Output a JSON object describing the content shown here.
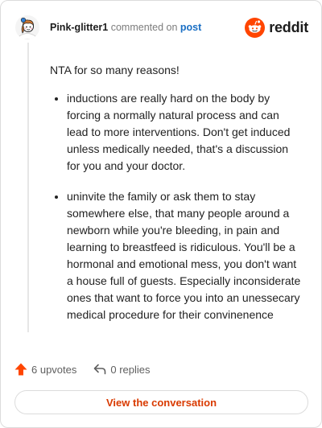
{
  "header": {
    "username": "Pink-glitter1",
    "action_text": "commented on",
    "post_link": "post",
    "brand_name": "reddit"
  },
  "comment": {
    "intro": "NTA for so many reasons!",
    "points": [
      "inductions are really hard on the body by forcing a normally natural process and can lead to more interventions. Don't get induced unless medically needed, that's a discussion for you and your doctor.",
      "uninvite the family or ask them to stay somewhere else, that many people around a newborn while you're bleeding, in pain and learning to breastfeed is ridiculous. You'll be a hormonal and emotional mess, you don't want a house full of guests. Especially inconsiderate ones that want to force you into an unessecary medical procedure for their convinenence"
    ]
  },
  "actions": {
    "upvotes": "6 upvotes",
    "replies": "0 replies"
  },
  "cta": {
    "label": "View the conversation"
  },
  "colors": {
    "brand": "#ff4500",
    "link": "#1a6fc4",
    "cta_text": "#d93a00",
    "upvote": "#ff4500"
  },
  "icons": {
    "avatar": "avatar",
    "brand": "reddit-logo-icon",
    "upvote": "upvote-arrow-icon",
    "reply": "reply-arrow-icon"
  }
}
